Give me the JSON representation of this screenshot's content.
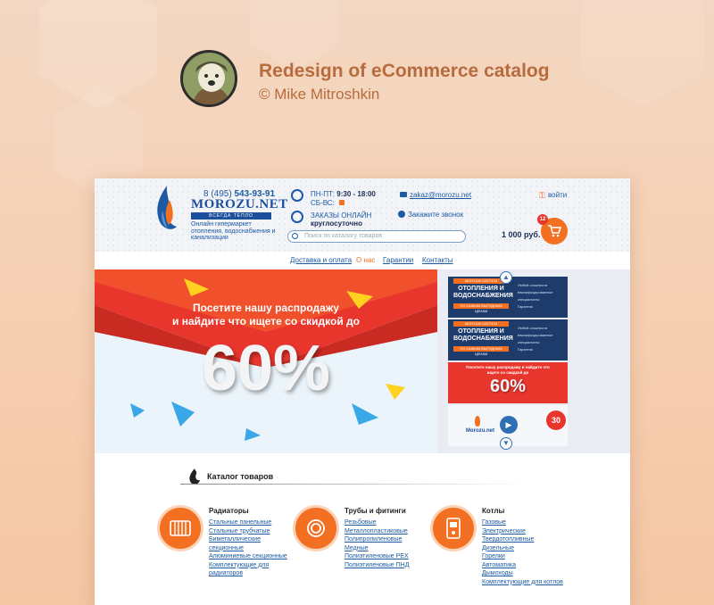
{
  "presentation": {
    "title": "Redesign of eCommerce catalog",
    "subtitle": "© Mike Mitroshkin"
  },
  "header": {
    "phone_prefix": "8 (495)",
    "phone_number": "543-93-91",
    "logo_name": "MOROZU.NET",
    "logo_tagline": "ВСЕГДА ТЕПЛО",
    "logo_description": "Онлайн гипермаркет отопления, водоснабжения и канализации",
    "hours_weekdays_label": "ПН-ПТ:",
    "hours_weekdays_value": "9:30 - 18:00",
    "hours_weekend_label": "СБ-ВС:",
    "orders_label": "ЗАКАЗЫ ОНЛАЙН",
    "orders_value": "круглосуточно",
    "email": "zakaz@morozu.net",
    "callback": "Закажите звонок",
    "login": "войти",
    "search_placeholder": "Поиск по каталогу товаров",
    "cart_total": "1 000 руб.",
    "cart_count": "12"
  },
  "nav": {
    "items": [
      "Доставка и оплата",
      "О нас",
      "Гарантии",
      "Контакты"
    ]
  },
  "banner": {
    "line1": "Посетите нашу распродажу",
    "line2": "и найдите что ищете со скидкой до",
    "discount": "60%"
  },
  "thumbs": {
    "t1_badge": "МОНТАЖ СИСТЕМ",
    "t1_title": "ОТОПЛЕНИЯ И ВОДОСНАБЖЕНИЯ",
    "t1_tag": "ПО САМЫМ ВЫГОДНЫМ ЦЕНАМ",
    "t1_list": [
      "Любой сложности",
      "Квалифицированные специалисты",
      "Гарантия"
    ],
    "t2_badge": "МОНТАЖ СИСТЕМ",
    "t2_title": "ОТОПЛЕНИЯ И ВОДОСНАБЖЕНИЯ",
    "t2_tag": "ПО САМЫМ ВЫГОДНЫМ ЦЕНАМ",
    "t2_list": [
      "Любой сложности",
      "Квалифицированные специалисты",
      "Гарантия"
    ],
    "t3_text": "Посетите нашу распродажу и найдите что ищете со скидкой до",
    "t3_discount": "60%",
    "t4_logo": "Morozu.net",
    "t4_badge": "30"
  },
  "catalog": {
    "title": "Каталог товаров",
    "categories": [
      {
        "name": "Радиаторы",
        "items": [
          "Стальные панельные",
          "Стальные трубчатые",
          "Биметаллические",
          "секционные",
          "Алюминиевые секционные",
          "Комплектующие для",
          "радиаторов"
        ]
      },
      {
        "name": "Трубы и фитинги",
        "items": [
          "Резьбовые",
          "Металлопластиковые",
          "Полипропиленовые",
          "Медные",
          "Полиэтиленовые PEX",
          "Полиэтиленовые ПНД"
        ]
      },
      {
        "name": "Котлы",
        "items": [
          "Газовые",
          "Электрические",
          "Твердотопливные",
          "Дизельные",
          "Горелки",
          "Автоматика",
          "Дымоходы",
          "Комплектующие для котлов"
        ]
      }
    ]
  },
  "colors": {
    "accent": "#f36f21",
    "brand_blue": "#1c5aa3",
    "banner_red": "#e8362d",
    "presentation_text": "#b86b3c"
  }
}
